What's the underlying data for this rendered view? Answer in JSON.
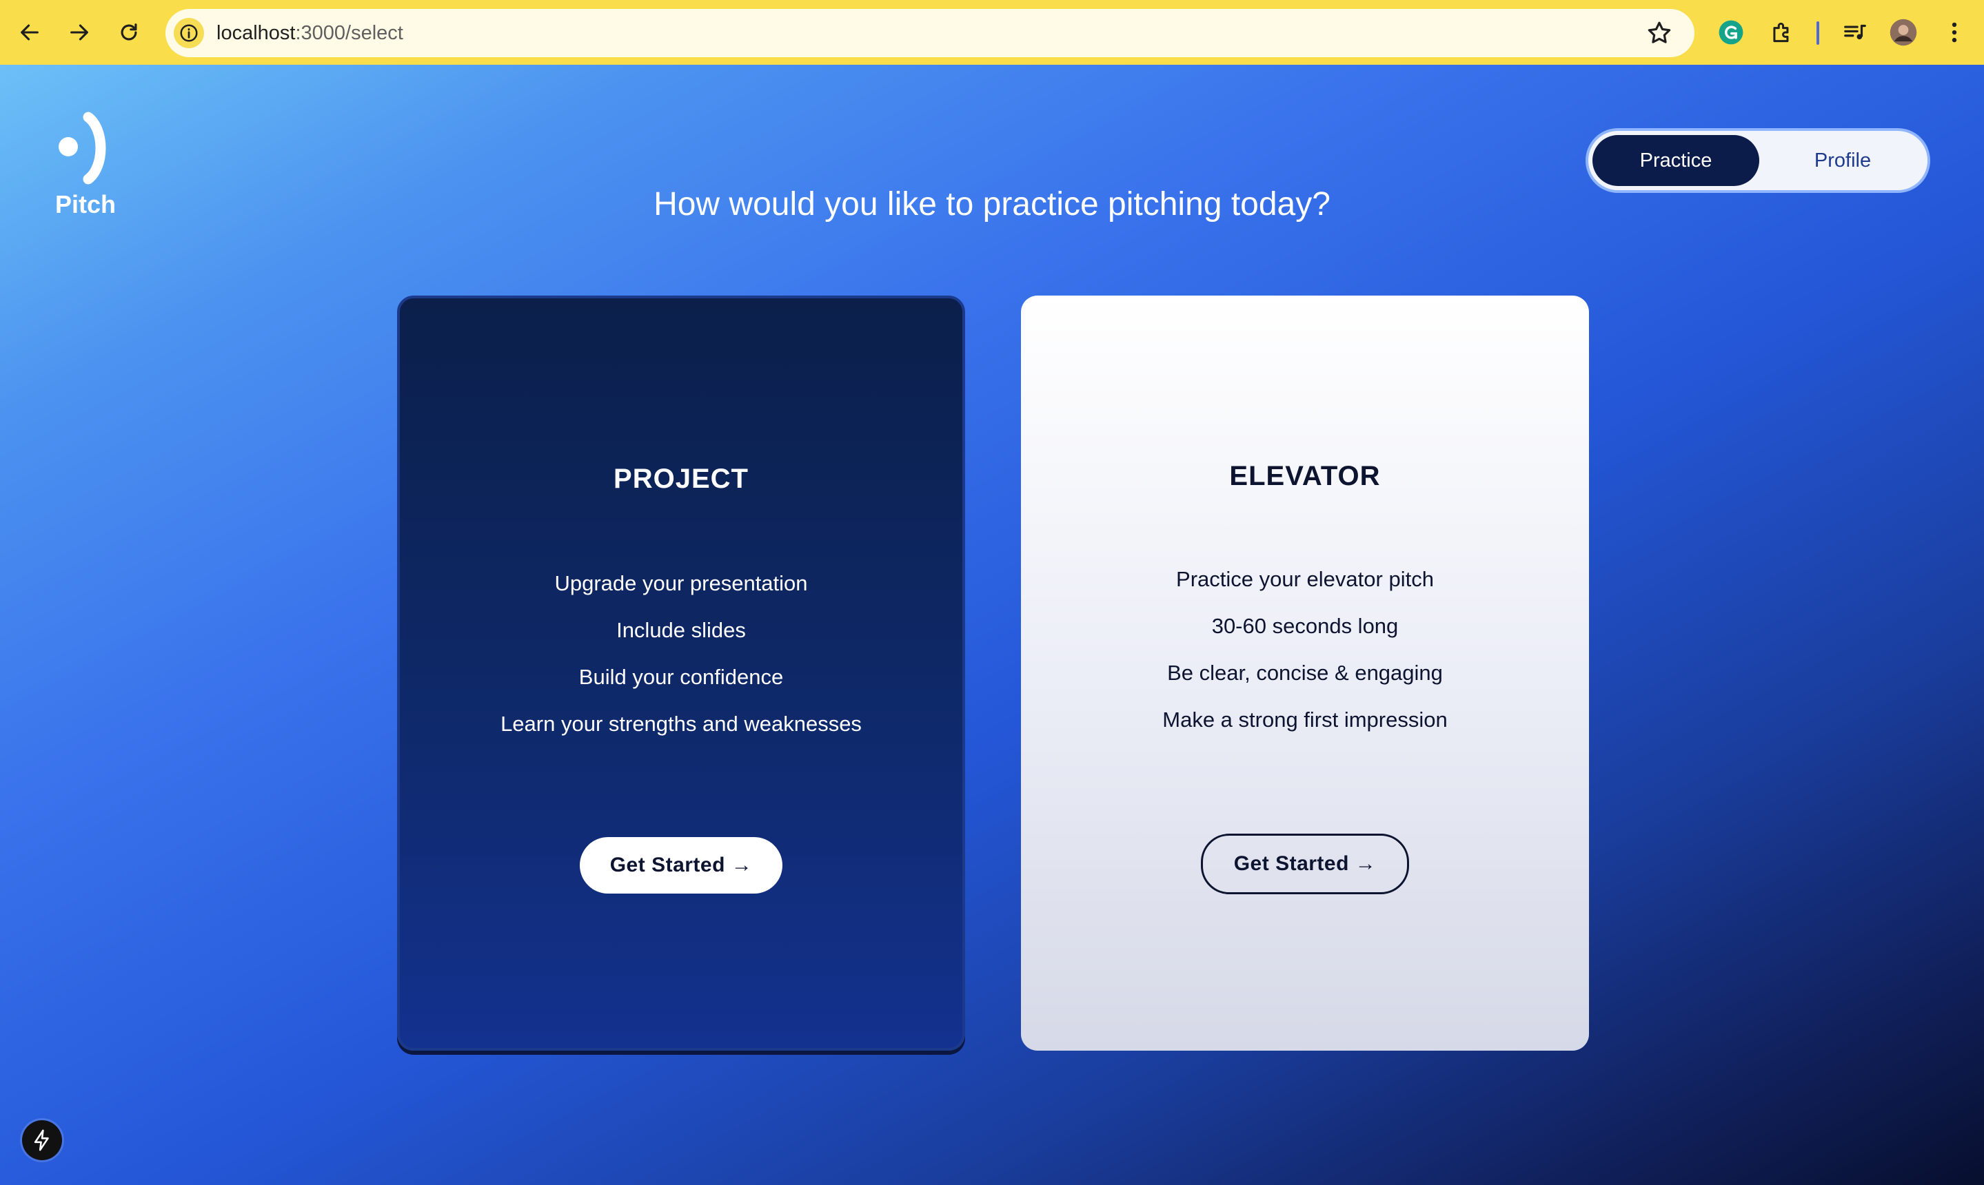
{
  "browser": {
    "url_host": "localhost",
    "url_path": ":3000/select"
  },
  "brand": {
    "name": "Pitch"
  },
  "nav": {
    "toggle": [
      {
        "label": "Practice",
        "active": true
      },
      {
        "label": "Profile",
        "active": false
      }
    ]
  },
  "headline": "How would you like to practice pitching today?",
  "cards": [
    {
      "title": "PROJECT",
      "features": [
        "Upgrade your presentation",
        "Include slides",
        "Build your confidence",
        "Learn your strengths and weaknesses"
      ],
      "cta": "Get Started →"
    },
    {
      "title": "ELEVATOR",
      "features": [
        "Practice your elevator pitch",
        "30-60 seconds long",
        "Be clear, concise & engaging",
        "Make a strong first impression"
      ],
      "cta": "Get Started →"
    }
  ],
  "colors": {
    "chrome": "#f9dd4a",
    "primary_dark": "#0b1b4a",
    "accent_blue": "#2457d8"
  }
}
